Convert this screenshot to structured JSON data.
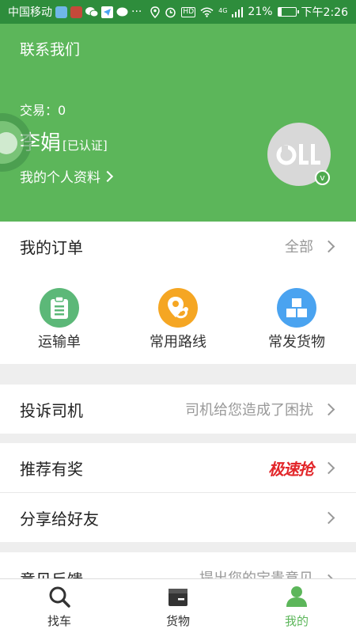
{
  "statusbar": {
    "carrier": "中国移动",
    "icons": [
      "app-notification-icon",
      "app-notification-icon",
      "wechat-icon",
      "telegram-icon",
      "message-icon",
      "more-icon"
    ],
    "more": "···",
    "hd": "HD",
    "network": "4G",
    "battery": "21%",
    "battery_level": 0.21,
    "time": "下午2:26"
  },
  "header": {
    "contact": "联系我们",
    "trades_label": "交易：",
    "trades_value": "0",
    "name": "李娟",
    "verified": "[已认证]",
    "profile_link": "我的个人资料",
    "avatar_badge": "v"
  },
  "orders": {
    "title": "我的订单",
    "all": "全部",
    "items": [
      {
        "label": "运输单",
        "icon": "clipboard-icon",
        "color": "#5cb878"
      },
      {
        "label": "常用路线",
        "icon": "route-pin-icon",
        "color": "#f5a623"
      },
      {
        "label": "常发货物",
        "icon": "boxes-icon",
        "color": "#4aa3f0"
      }
    ]
  },
  "complaint": {
    "title": "投诉司机",
    "hint": "司机给您造成了困扰"
  },
  "referral": {
    "title": "推荐有奖",
    "promo": "极速抢"
  },
  "share": {
    "title": "分享给好友"
  },
  "feedback": {
    "title": "意见反馈",
    "hint": "提出您的宝贵意见"
  },
  "nav": [
    {
      "label": "找车",
      "icon": "search-icon"
    },
    {
      "label": "货物",
      "icon": "cargo-box-icon"
    },
    {
      "label": "我的",
      "icon": "person-icon",
      "active": true
    }
  ],
  "colors": {
    "brand_green": "#5cb65a",
    "statusbar_green": "#2e8d3c",
    "promo_red": "#e2262a"
  }
}
